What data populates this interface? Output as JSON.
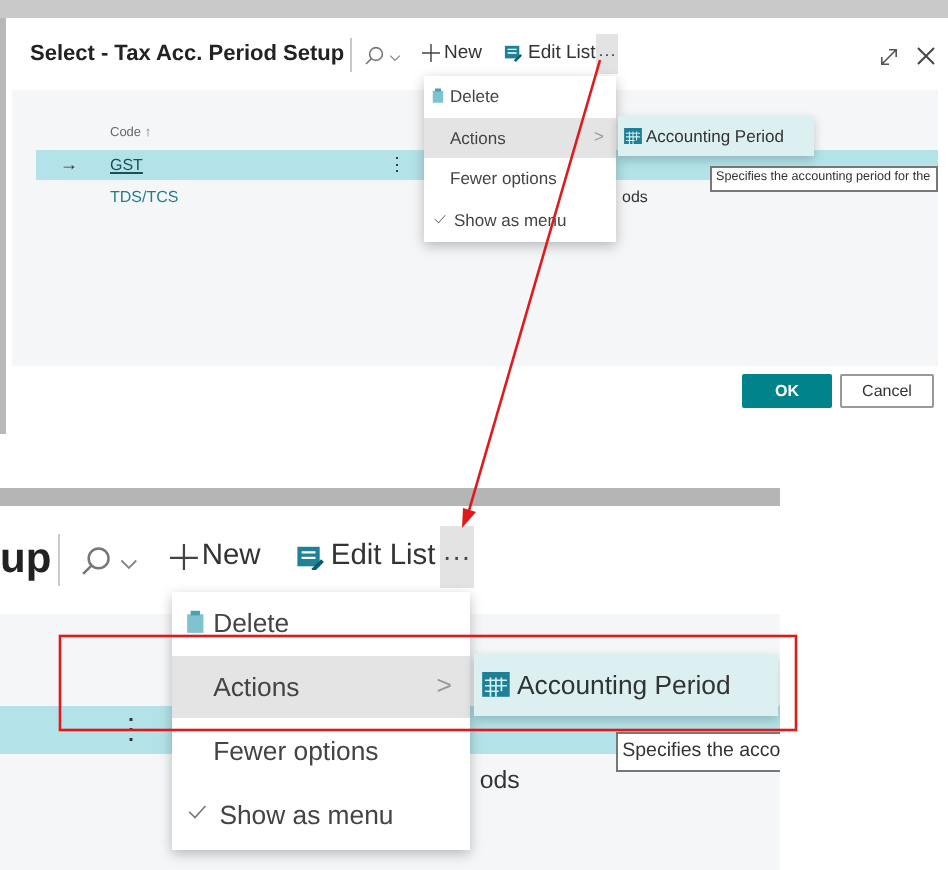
{
  "dialog": {
    "title": "Select - Tax Acc. Period Setup",
    "toolbar": {
      "new": "New",
      "edit_list": "Edit List",
      "more": "···"
    },
    "column_header": "Code ↑",
    "rows": [
      {
        "selected": true,
        "marker": "→",
        "code": "GST",
        "row_menu": "⋮"
      },
      {
        "selected": false,
        "code": "TDS/TCS",
        "column_2": "ods"
      }
    ],
    "menu": [
      {
        "kind": "delete",
        "label": "Delete",
        "selected": false
      },
      {
        "kind": "submenu",
        "label": "Actions",
        "chevron": ">",
        "selected": true
      },
      {
        "kind": "plain",
        "label": "Fewer options",
        "selected": false
      },
      {
        "kind": "check",
        "label": "Show as menu",
        "checked": true,
        "selected": false
      }
    ],
    "submenu": [
      {
        "label": "Accounting Period",
        "selected": true
      }
    ],
    "tooltip": "Specifies the accounting period for the",
    "buttons": [
      {
        "kind": "primary",
        "label": "OK"
      },
      {
        "kind": "secondary",
        "label": "Cancel"
      }
    ]
  },
  "zoomed_view": {
    "title": "up",
    "toolbar": {
      "new": "New",
      "edit_list": "Edit List",
      "more": "···"
    },
    "rows": [
      {
        "selected": true,
        "row_menu": "⋮"
      },
      {
        "selected": false,
        "column_2": "ods"
      }
    ],
    "menu": [
      {
        "kind": "delete",
        "label": "Delete",
        "selected": false
      },
      {
        "kind": "submenu",
        "label": "Actions",
        "chevron": ">",
        "selected": true
      },
      {
        "kind": "plain",
        "label": "Fewer options",
        "selected": false
      },
      {
        "kind": "check",
        "label": "Show as menu",
        "checked": true,
        "selected": false
      }
    ],
    "submenu": [
      {
        "label": "Accounting Period",
        "selected": true
      }
    ],
    "tooltip": "Specifies the acco"
  }
}
